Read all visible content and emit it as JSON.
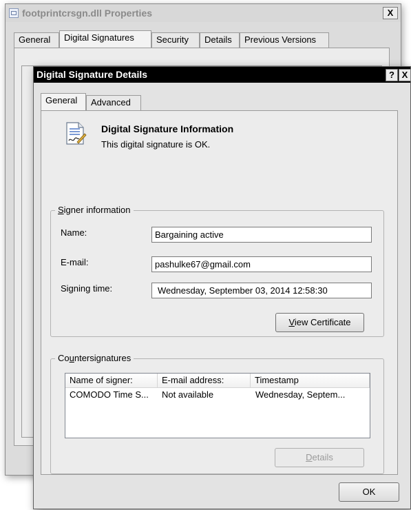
{
  "back_window": {
    "title": "footprintcrsgn.dll Properties",
    "close_label": "X",
    "tabs": [
      {
        "label": "General"
      },
      {
        "label": "Digital Signatures"
      },
      {
        "label": "Security"
      },
      {
        "label": "Details"
      },
      {
        "label": "Previous Versions"
      }
    ]
  },
  "dialog": {
    "title": "Digital Signature Details",
    "help_label": "?",
    "close_label": "X",
    "tabs": [
      {
        "label": "General"
      },
      {
        "label": "Advanced"
      }
    ],
    "info": {
      "icon": "certificate-document-icon",
      "heading": "Digital Signature Information",
      "status": "This digital signature is OK."
    },
    "signer": {
      "legend_accel": "S",
      "legend_rest": "igner information",
      "name_label": "Name:",
      "name_value": "Bargaining active",
      "email_label": "E-mail:",
      "email_value": "pashulke67@gmail.com",
      "time_label": "Signing time:",
      "time_value": "Wednesday,  September  03,  2014 12:58:30",
      "view_cert_accel": "V",
      "view_cert_rest": "iew Certificate"
    },
    "countersignatures": {
      "legend_pre": "Co",
      "legend_accel": "u",
      "legend_post": "ntersignatures",
      "columns": [
        "Name of signer:",
        "E-mail address:",
        "Timestamp"
      ],
      "rows": [
        {
          "name": "COMODO Time S...",
          "email": "Not available",
          "timestamp": "Wednesday, Septem..."
        }
      ],
      "details_accel": "D",
      "details_rest": "etails"
    },
    "ok_label": "OK"
  }
}
